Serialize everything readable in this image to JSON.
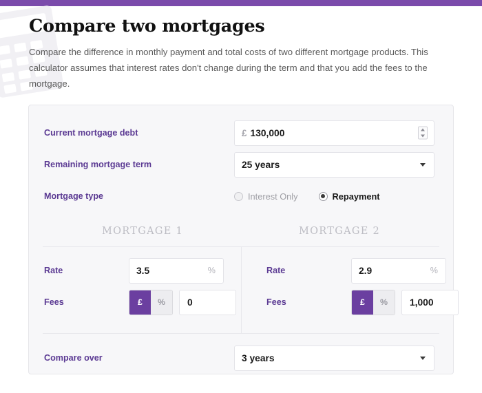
{
  "theme": {
    "topbar_color": "#7b4bab",
    "label_color": "#5b3a93",
    "toggle_active_color": "#6b3fa0",
    "panel_bg": "#f7f7f9"
  },
  "header": {
    "title": "Compare two mortgages",
    "intro": "Compare the difference in monthly payment and total costs of two different mortgage products. This calculator assumes that interest rates don't change during the term and that you add the fees to the mortgage."
  },
  "form": {
    "current_debt": {
      "label": "Current mortgage debt",
      "currency_symbol": "£",
      "value": "130,000",
      "spinner": "number-spinner"
    },
    "remaining_term": {
      "label": "Remaining mortgage term",
      "value": "25 years"
    },
    "mortgage_type": {
      "label": "Mortgage type",
      "options": [
        {
          "label": "Interest Only",
          "selected": false
        },
        {
          "label": "Repayment",
          "selected": true
        }
      ]
    },
    "compare_over": {
      "label": "Compare over",
      "value": "3 years"
    }
  },
  "columns": [
    {
      "heading": "MORTGAGE 1",
      "rate": {
        "label": "Rate",
        "value": "3.5",
        "suffix": "%"
      },
      "fees": {
        "label": "Fees",
        "unit_options": [
          {
            "label": "£",
            "active": true
          },
          {
            "label": "%",
            "active": false
          }
        ],
        "value": "0"
      }
    },
    {
      "heading": "MORTGAGE 2",
      "rate": {
        "label": "Rate",
        "value": "2.9",
        "suffix": "%"
      },
      "fees": {
        "label": "Fees",
        "unit_options": [
          {
            "label": "£",
            "active": true
          },
          {
            "label": "%",
            "active": false
          }
        ],
        "value": "1,000"
      }
    }
  ]
}
